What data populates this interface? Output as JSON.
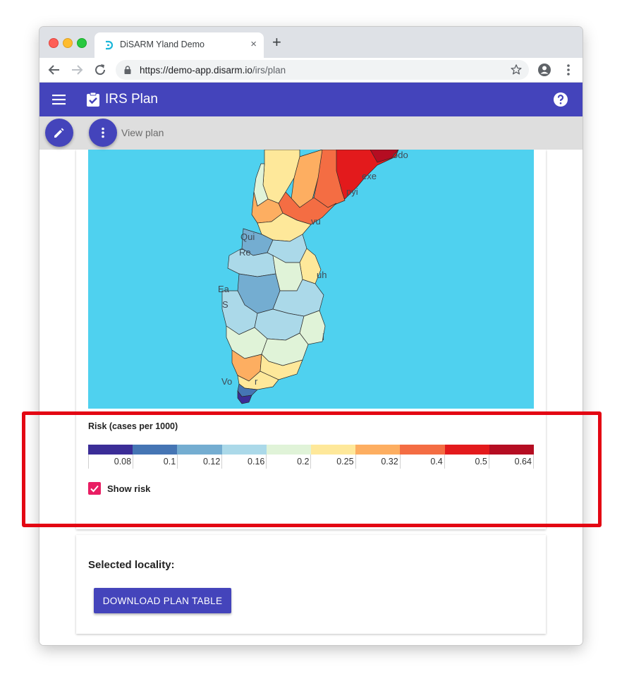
{
  "browser": {
    "tab_title": "DiSARM Yland Demo",
    "tab_close_glyph": "×",
    "new_tab_glyph": "+",
    "url_host": "https://demo-app.disarm.io",
    "url_path": "/irs/plan"
  },
  "appbar": {
    "title": "IRS Plan",
    "icons": [
      "menu-icon",
      "clipboard-check-icon",
      "help-icon"
    ],
    "color": "#4444bb"
  },
  "subbar": {
    "label": "View plan",
    "icons": [
      "edit-icon",
      "more-vert-icon"
    ]
  },
  "map": {
    "labels": [
      "odo",
      "exe",
      "pyi",
      "vu",
      "Qui",
      "Re",
      "uh",
      "Ea",
      "S",
      "i",
      "Vo",
      "r"
    ],
    "water_color": "#4fd1ef"
  },
  "legend": {
    "title": "Risk (cases per 1000)",
    "colors": [
      "#3b2d97",
      "#4575b4",
      "#74add1",
      "#abd9e9",
      "#e0f3d8",
      "#fee89a",
      "#fdae61",
      "#f46d43",
      "#e31a1c",
      "#b50d22"
    ],
    "ticks": [
      "0.08",
      "0.1",
      "0.12",
      "0.16",
      "0.2",
      "0.25",
      "0.32",
      "0.4",
      "0.5",
      "0.64"
    ]
  },
  "show_risk": {
    "label": "Show risk",
    "checked": true,
    "color": "#e91e63"
  },
  "locality": {
    "heading": "Selected locality:",
    "download_label": "DOWNLOAD PLAN TABLE"
  },
  "annotation": {
    "color": "#e30613"
  }
}
